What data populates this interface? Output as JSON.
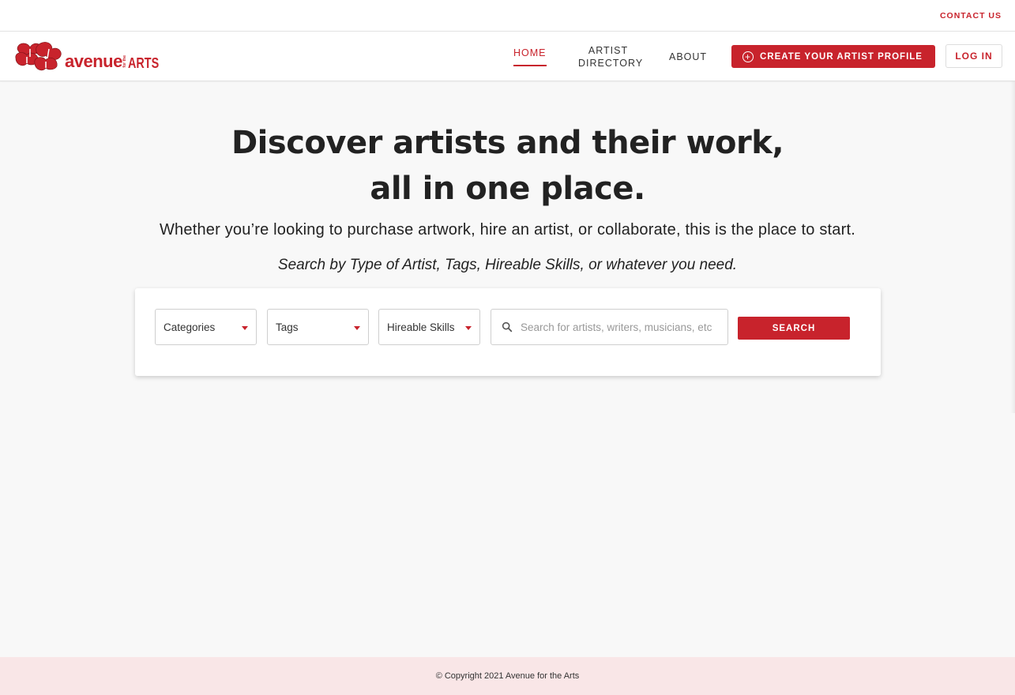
{
  "topbar": {
    "contact_label": "CONTACT US"
  },
  "brand": {
    "name_main": "avenue",
    "name_small": "for the",
    "name_tail": "ARTS",
    "color": "#c8232c"
  },
  "nav": {
    "home_label": "HOME",
    "directory_line1": "ARTIST",
    "directory_line2": "DIRECTORY",
    "about_label": "ABOUT",
    "create_label": "CREATE YOUR ARTIST PROFILE",
    "login_label": "LOG IN",
    "active": "home"
  },
  "hero": {
    "title_line1": "Discover artists and their work,",
    "title_line2": "all in one place.",
    "subtitle": "Whether you’re looking to purchase artwork, hire an artist, or collaborate, this is the place to start.",
    "hint": "Search by Type of Artist, Tags, Hireable Skills, or whatever you need."
  },
  "search": {
    "categories_label": "Categories",
    "tags_label": "Tags",
    "skills_label": "Hireable Skills",
    "input_value": "",
    "input_placeholder": "Search for artists, writers, musicians, etc",
    "button_label": "SEARCH"
  },
  "footer": {
    "copyright": "© Copyright 2021 Avenue for the Arts"
  },
  "colors": {
    "accent": "#c8232c",
    "page_bg": "#f8f8f8",
    "footer_bg": "#f9e6e7"
  },
  "icons": [
    "plus-circle-icon",
    "search-icon",
    "caret-down-icon",
    "logo-mark-icon"
  ]
}
